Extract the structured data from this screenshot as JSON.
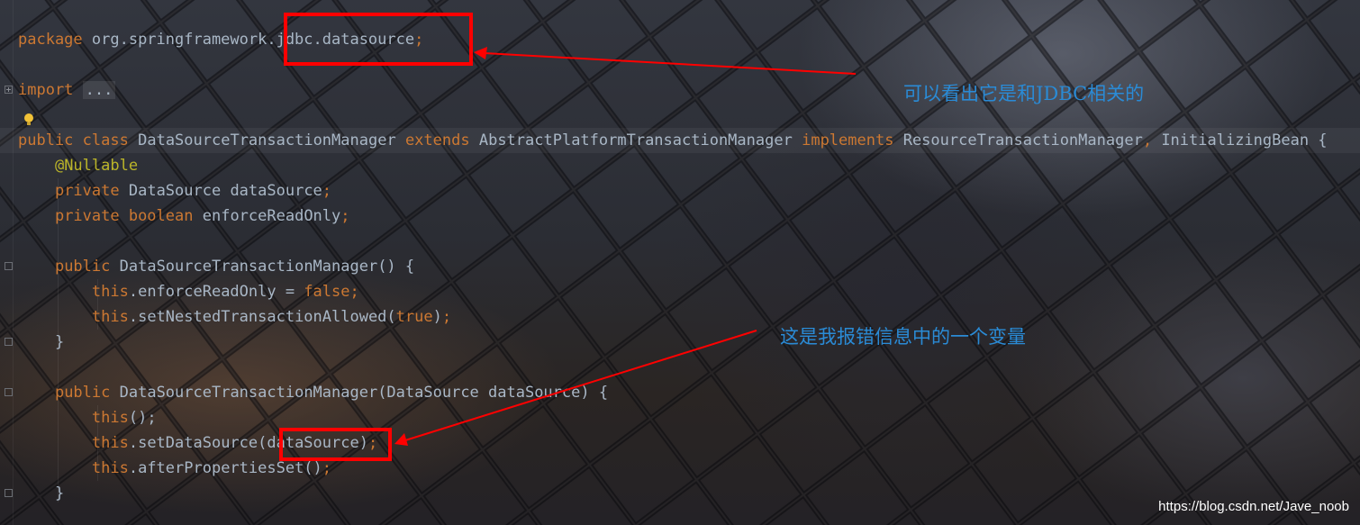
{
  "code": {
    "package_kw": "package",
    "package_name": " org.springframework.jdbc.datasource",
    "semicolon": ";",
    "import_kw": "import",
    "import_folded": "...",
    "class_decl": {
      "public_kw": "public",
      "class_kw": "class",
      "name": "DataSourceTransactionManager",
      "extends_kw": "extends",
      "parent": "AbstractPlatformTransactionManager",
      "implements_kw": "implements",
      "iface1": "ResourceTransactionManager",
      "comma": ",",
      "iface2": "InitializingBean {"
    },
    "annotation": "@Nullable",
    "field1_kw": "private",
    "field1_rest": "DataSource dataSource",
    "field2_kw": "private boolean",
    "field2_rest": "enforceReadOnly",
    "ctor1": {
      "public_kw": "public",
      "sig": "DataSourceTransactionManager() {",
      "this1": "this",
      "stmt1": ".enforceReadOnly = ",
      "false_kw": "false",
      "this2": "this",
      "stmt2": ".setNestedTransactionAllowed(",
      "true_kw": "true",
      "stmt2_end": ")"
    },
    "ctor2": {
      "public_kw": "public",
      "sig": "DataSourceTransactionManager(DataSource dataSource) {",
      "this1": "this",
      "stmt1": "();",
      "this2": "this",
      "stmt2": ".setDataSource(dataSource)",
      "this3": "this",
      "stmt3": ".afterPropertiesSet()"
    },
    "close_brace": "}"
  },
  "annotations": {
    "note1": "可以看出它是和JDBC相关的",
    "note2": "这是我报错信息中的一个变量"
  },
  "watermark": "https://blog.csdn.net/Jave_noob",
  "colors": {
    "keyword": "#cc7832",
    "identifier": "#a9b7c6",
    "annotation": "#bbb529",
    "note_text": "#2a8bd6",
    "highlight_box": "#ff0000"
  }
}
